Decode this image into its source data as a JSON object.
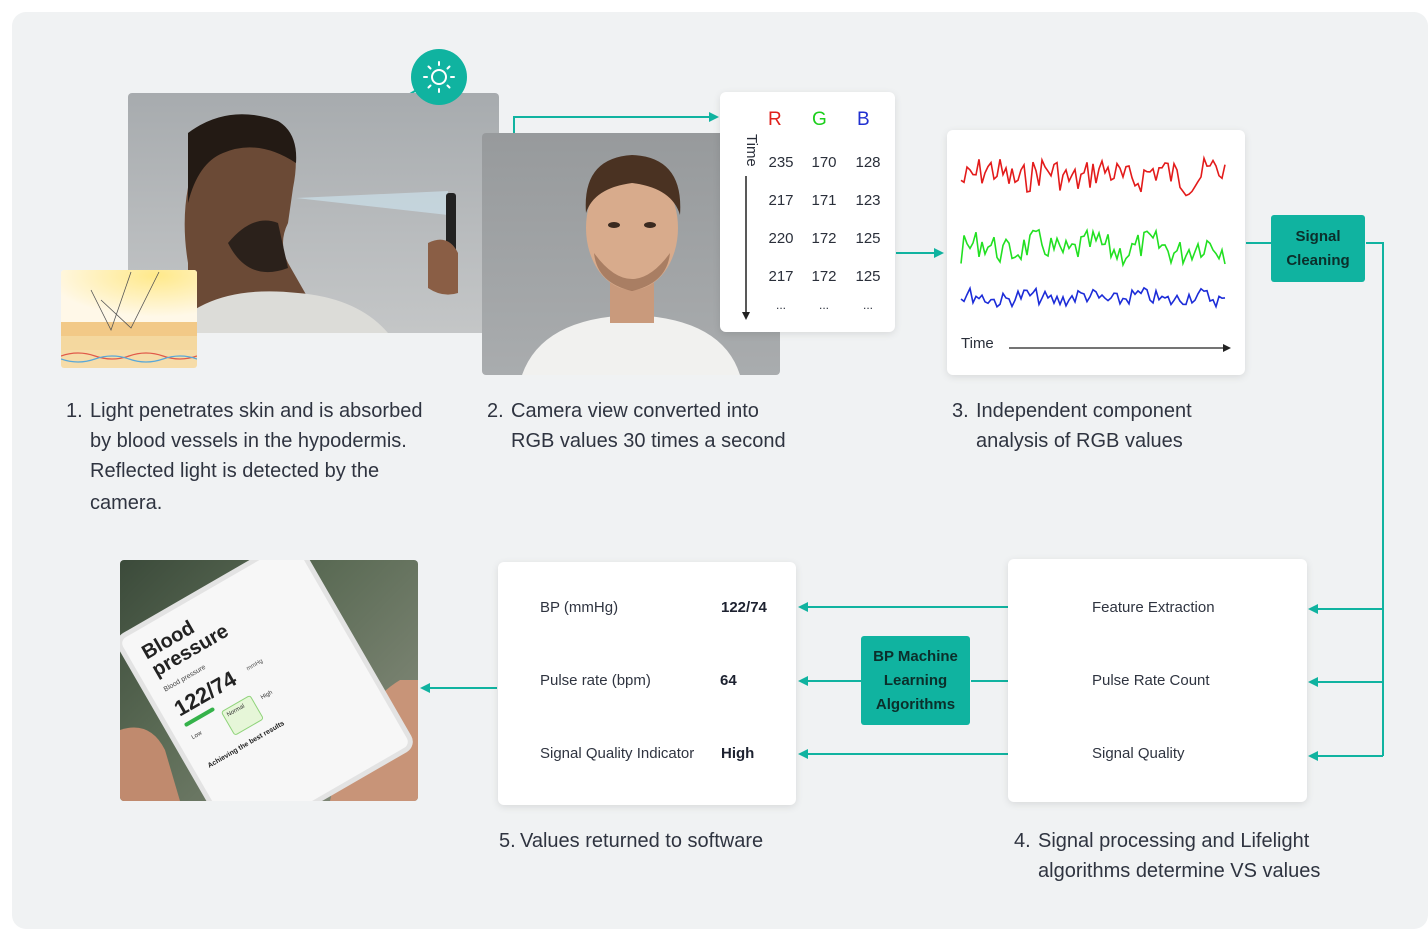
{
  "steps": [
    {
      "num": "1.",
      "lines": [
        "Light penetrates skin and is absorbed",
        "by blood vessels in the hypodermis.",
        "Reflected light is detected by the",
        "camera."
      ]
    },
    {
      "num": "2.",
      "lines": [
        "Camera view converted into",
        "RGB values 30 times a second"
      ]
    },
    {
      "num": "3.",
      "lines": [
        "Independent component",
        "analysis of RGB values"
      ]
    },
    {
      "num": "4.",
      "lines": [
        "Signal processing and Lifelight",
        "algorithms determine VS values"
      ]
    },
    {
      "num": "5.",
      "lines": [
        "Values returned to software"
      ]
    }
  ],
  "rgb_table": {
    "headers": [
      "R",
      "G",
      "B"
    ],
    "header_colors": [
      "#e0201c",
      "#1ccf1c",
      "#2030d0"
    ],
    "axis_label": "Time",
    "rows": [
      [
        "235",
        "170",
        "128"
      ],
      [
        "217",
        "171",
        "123"
      ],
      [
        "220",
        "172",
        "125"
      ],
      [
        "217",
        "172",
        "125"
      ],
      [
        "...",
        "...",
        "..."
      ]
    ]
  },
  "waveform": {
    "axis_label": "Time",
    "colors": [
      "#e31b1b",
      "#22e022",
      "#1c2cd8"
    ]
  },
  "signal_cleaning": {
    "line1": "Signal",
    "line2": "Cleaning"
  },
  "processing": {
    "items": [
      "Feature Extraction",
      "Pulse Rate Count",
      "Signal Quality"
    ]
  },
  "ml_box": {
    "line1": "BP Machine",
    "line2": "Learning",
    "line3": "Algorithms"
  },
  "results": {
    "rows": [
      {
        "label": "BP (mmHg)",
        "value": "122/74"
      },
      {
        "label": "Pulse rate (bpm)",
        "value": "64"
      },
      {
        "label": "Signal Quality Indicator",
        "value": "High"
      }
    ]
  },
  "tablet": {
    "title_1": "Blood",
    "title_2": "pressure",
    "subtitle": "Blood pressure",
    "reading": "122/74",
    "unit": "mmHg",
    "levels": [
      "Low",
      "Normal",
      "High"
    ],
    "tips_title": "Achieving the best results"
  },
  "accent": "#10b3a0",
  "icons": [
    "sun-icon"
  ]
}
